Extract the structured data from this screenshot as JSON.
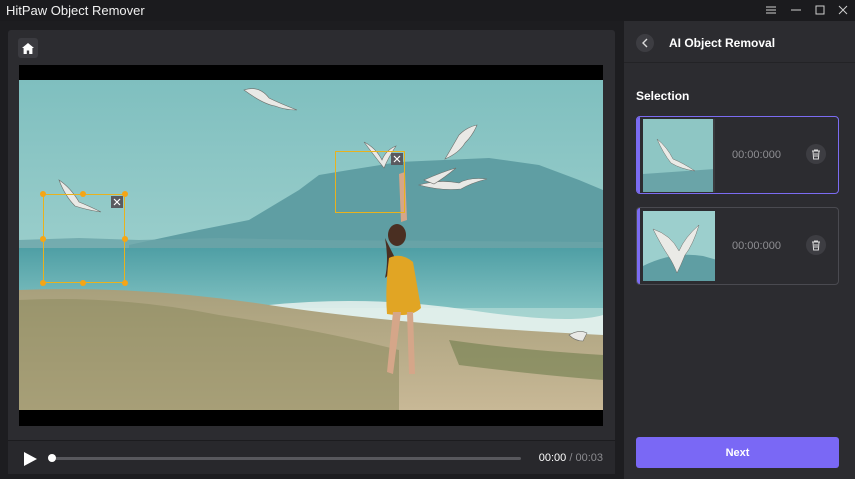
{
  "window": {
    "title": "HitPaw Object Remover",
    "controls": [
      "menu-icon",
      "minimize-icon",
      "maximize-icon",
      "close-icon"
    ]
  },
  "editor": {
    "home_icon": "home-icon",
    "playbar": {
      "play_icon": "play-icon",
      "progress": 0,
      "current_time": "00:00",
      "separator": "/",
      "duration": "00:03"
    }
  },
  "side_panel": {
    "back_icon": "chevron-left-icon",
    "title": "AI Object Removal",
    "section_label": "Selection",
    "selections": [
      {
        "timecode": "00:00:000",
        "active": true,
        "delete_icon": "trash-icon"
      },
      {
        "timecode": "00:00:000",
        "active": false,
        "delete_icon": "trash-icon"
      }
    ],
    "next_label": "Next"
  },
  "colors": {
    "accent": "#7a68f5",
    "selection_box": "#e8b21e",
    "background": "#1d1d20",
    "panel": "#2c2c30"
  }
}
